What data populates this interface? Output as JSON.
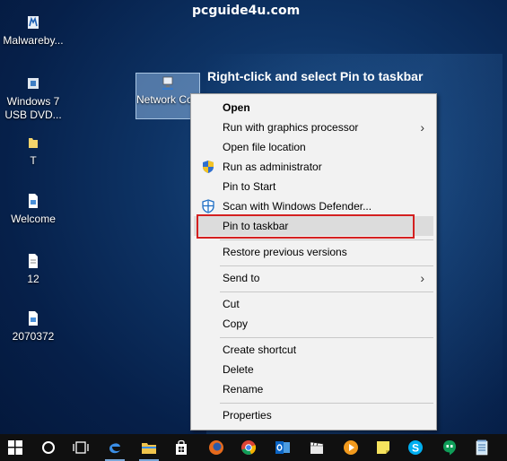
{
  "watermark": "pcguide4u.com",
  "caption": "Right-click and select Pin to taskbar",
  "desktop_icons": [
    {
      "label": "Malwareby...",
      "icon": "malwarebytes-icon"
    },
    {
      "label": "Windows 7 USB DVD...",
      "icon": "usb-dvd-tool-icon"
    },
    {
      "label": "T",
      "icon": "folder-icon"
    },
    {
      "label": "Welcome",
      "icon": "image-file-icon"
    },
    {
      "label": "12",
      "icon": "text-file-icon"
    },
    {
      "label": "2070372",
      "icon": "image-file-icon"
    }
  ],
  "selected_icon": {
    "label": "Network Connection...",
    "icon": "network-connections-icon"
  },
  "context_menu": {
    "items": [
      {
        "label": "Open",
        "bold": true
      },
      {
        "label": "Run with graphics processor",
        "submenu": true
      },
      {
        "label": "Open file location"
      },
      {
        "label": "Run as administrator",
        "icon": "uac-shield-icon"
      },
      {
        "label": "Pin to Start"
      },
      {
        "label": "Scan with Windows Defender...",
        "icon": "windows-defender-icon"
      },
      {
        "label": "Pin to taskbar",
        "highlighted": true
      },
      {
        "label": "Restore previous versions"
      },
      {
        "label": "Send to",
        "submenu": true
      },
      {
        "label": "Cut"
      },
      {
        "label": "Copy"
      },
      {
        "label": "Create shortcut"
      },
      {
        "label": "Delete"
      },
      {
        "label": "Rename"
      },
      {
        "label": "Properties"
      }
    ]
  },
  "taskbar": {
    "items": [
      "start-button-windows-icon",
      "cortana-search-icon",
      "task-view-icon",
      "edge-icon",
      "file-explorer-icon",
      "store-icon",
      "firefox-icon",
      "chrome-icon",
      "outlook-icon",
      "movie-maker-icon",
      "media-player-icon",
      "sticky-notes-icon",
      "skype-icon",
      "hangouts-icon",
      "notepad-icon"
    ]
  },
  "colors": {
    "highlight_border": "#d42020",
    "menu_background": "#f2f2f2",
    "desktop_background": "#0e3466"
  }
}
